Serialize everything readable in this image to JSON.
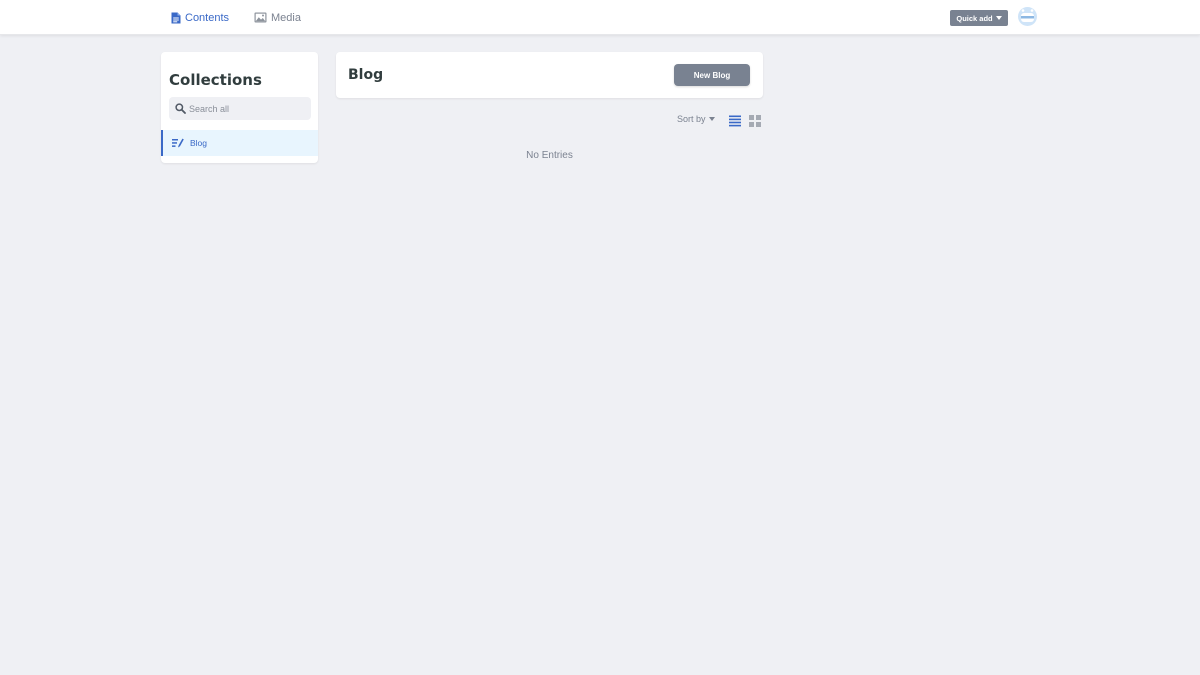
{
  "topbar": {
    "nav": [
      {
        "label": "Contents",
        "icon": "document-icon",
        "active": true
      },
      {
        "label": "Media",
        "icon": "image-icon",
        "active": false
      }
    ],
    "quick_add_label": "Quick add",
    "avatar_icon": "user-avatar-icon"
  },
  "sidebar": {
    "title": "Collections",
    "search_placeholder": "Search all",
    "collections": [
      {
        "label": "Blog",
        "icon": "pen-lines-icon",
        "active": true
      }
    ]
  },
  "main": {
    "title": "Blog",
    "new_button_label": "New Blog",
    "sort_label": "Sort by",
    "view_modes": [
      "list-view-icon",
      "grid-view-icon"
    ],
    "active_view": "list",
    "empty_message": "No Entries"
  },
  "colors": {
    "accent": "#3a69c7",
    "button_gray": "#798291",
    "background": "#eff0f4",
    "selected_bg": "#e8f5fe",
    "muted_text": "#7b8290"
  }
}
